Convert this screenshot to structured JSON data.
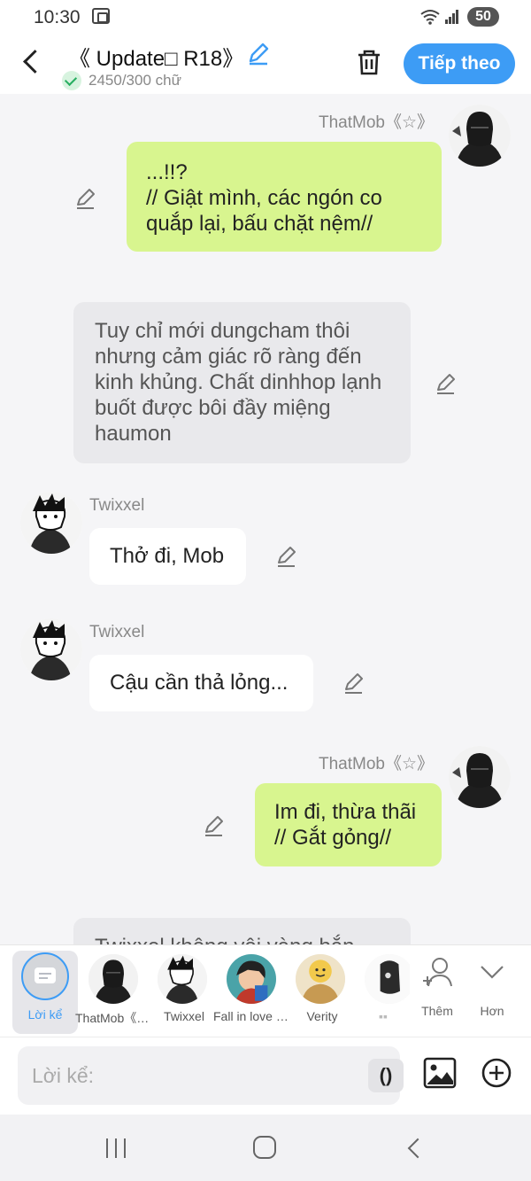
{
  "status": {
    "time": "10:30",
    "battery": "50"
  },
  "header": {
    "title": "《 Update□ R18》",
    "word_count": "2450/300 chữ",
    "next_label": "Tiếp theo"
  },
  "messages": [
    {
      "speaker": "ThatMob《☆》",
      "side": "right",
      "text": "...!!?\n// Giật mình, các ngón co quắp lại, bấu chặt nệm//"
    },
    {
      "speaker": "",
      "side": "narration",
      "text": "Tuy chỉ mới dungcham thôi nhưng cảm giác rõ ràng đến kinh khủng. Chất dinhhop lạnh buốt được bôi đầy miệng haumon"
    },
    {
      "speaker": "Twixxel",
      "side": "left",
      "text": "Thở đi, Mob"
    },
    {
      "speaker": "Twixxel",
      "side": "left",
      "text": "Cậu cần thả lỏng..."
    },
    {
      "speaker": "ThatMob《☆》",
      "side": "right",
      "text": "Im đi, thừa thãi\n// Gắt gỏng//"
    },
    {
      "speaker": "",
      "side": "narration",
      "text": "Twixxel không vội vàng bắn"
    }
  ],
  "characters": [
    {
      "label": "Lời kể",
      "selected": true
    },
    {
      "label": "ThatMob《☆》"
    },
    {
      "label": "Twixxel"
    },
    {
      "label": "Fall in love with you"
    },
    {
      "label": "Verity"
    },
    {
      "label": "▪▪"
    }
  ],
  "more": {
    "add_label": "Thêm",
    "more_label": "Hơn"
  },
  "composer": {
    "placeholder": "Lời kể:",
    "paren_label": "()"
  },
  "colors": {
    "accent": "#3d9cf5",
    "bubble_green": "#d8f58f",
    "narration_bg": "#e9e9ec"
  }
}
